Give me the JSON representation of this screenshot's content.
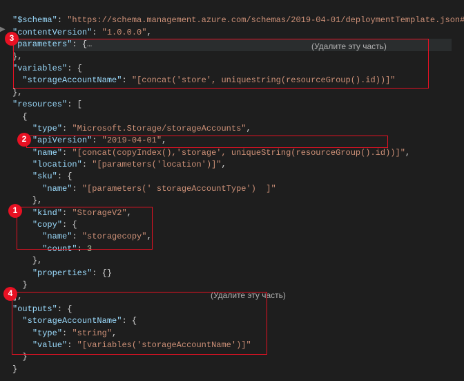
{
  "code": {
    "schema_key": "\"$schema\"",
    "schema_val": "\"https://schema.management.azure.com/schemas/2019-04-01/deploymentTemplate.json#\"",
    "contentVersion_key": "\"contentVersion\"",
    "contentVersion_val": "\"1.0.0.0\"",
    "parameters_key": "\"parameters\"",
    "param_ellipsis": "…",
    "variables_key": "\"variables\"",
    "storageAccountName_key": "\"storageAccountName\"",
    "storageAccountName_val": "\"[concat('store', uniquestring(resourceGroup().id))]\"",
    "resources_key": "\"resources\"",
    "type_key": "\"type\"",
    "type_val": "\"Microsoft.Storage/storageAccounts\"",
    "apiVersion_key": "\"apiVersion\"",
    "apiVersion_val": "\"2019-04-01\"",
    "name_key": "\"name\"",
    "name_val": "\"[concat(copyIndex(),'storage', uniqueString(resourceGroup().id))]\"",
    "location_key": "\"location\"",
    "location_val": "\"[parameters('location')]\"",
    "sku_key": "\"sku\"",
    "sku_name_key": "\"name\"",
    "sku_name_val": "\"[parameters(' storageAccountType')  ]\"",
    "kind_key": "\"kind\"",
    "kind_val": "\"StorageV2\"",
    "copy_key": "\"copy\"",
    "copy_name_key": "\"name\"",
    "copy_name_val": "\"storagecopy\"",
    "copy_count_key": "\"count\"",
    "copy_count_val": "3",
    "properties_key": "\"properties\"",
    "outputs_key": "\"outputs\"",
    "out_storageAccountName_key": "\"storageAccountName\"",
    "out_type_key": "\"type\"",
    "out_type_val": "\"string\"",
    "out_value_key": "\"value\"",
    "out_value_val": "\"[variables('storageAccountName')]\""
  },
  "labels": {
    "delete": "(Удалите эту часть)"
  },
  "callouts": {
    "c1": "1",
    "c2": "2",
    "c3": "3",
    "c4": "4"
  }
}
